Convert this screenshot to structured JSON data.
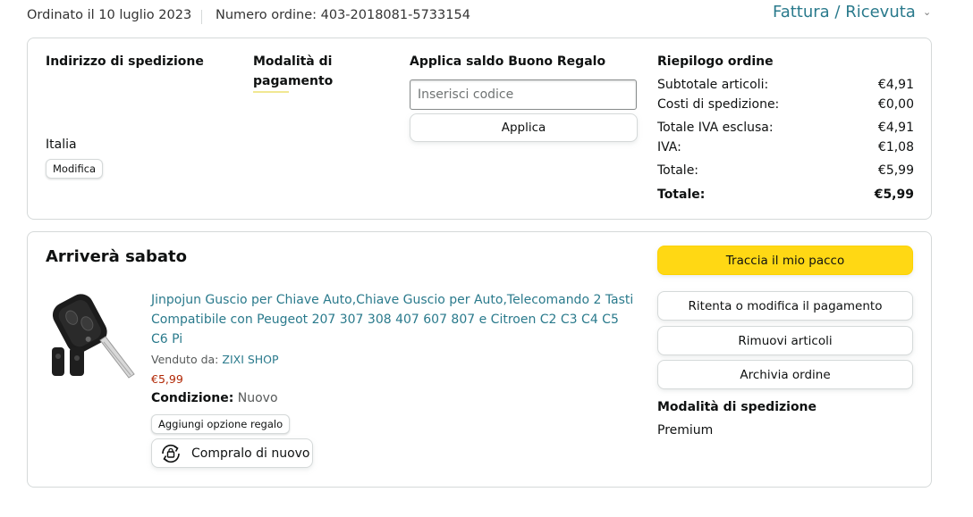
{
  "header": {
    "order_date": "Ordinato il 10 luglio 2023",
    "order_number": "Numero ordine: 403-2018081-5733154",
    "invoice_label": "Fattura / Ricevuta"
  },
  "summary_box": {
    "shipping_address": {
      "heading": "Indirizzo di spedizione",
      "country": "Italia",
      "edit_label": "Modifica"
    },
    "payment": {
      "heading_line1": "Modalità di",
      "heading_line2": "pagamento"
    },
    "gift_card": {
      "heading": "Applica saldo Buono Regalo",
      "placeholder": "Inserisci codice",
      "apply_label": "Applica"
    },
    "order_summary": {
      "heading": "Riepilogo ordine",
      "rows": [
        {
          "label": "Subtotale articoli:",
          "value": "€4,91",
          "bold": false
        },
        {
          "label": "Costi di spedizione:",
          "value": "€0,00",
          "bold": false
        },
        {
          "label": "Totale IVA esclusa:",
          "value": "€4,91",
          "bold": false
        },
        {
          "label": "IVA:",
          "value": "€1,08",
          "bold": false
        },
        {
          "label": "Totale:",
          "value": "€5,99",
          "bold": false
        },
        {
          "label": "Totale:",
          "value": "€5,99",
          "bold": true
        }
      ]
    }
  },
  "shipment": {
    "title": "Arriverà sabato",
    "product": {
      "title": "Jinpojun Guscio per Chiave Auto,Chiave Guscio per Auto,Telecomando 2 Tasti Compatibile con Peugeot 207 307 308 407 607 807 e Citroen C2 C3 C4 C5 C6 Pi",
      "sold_by_label": "Venduto da:",
      "seller": "ZIXI SHOP",
      "price": "€5,99",
      "condition_label": "Condizione:",
      "condition_value": "Nuovo",
      "gift_option_label": "Aggiungi opzione regalo",
      "buy_again_label": "Compralo di nuovo"
    },
    "actions": {
      "track": "Traccia il mio pacco",
      "retry_payment": "Ritenta o modifica il pagamento",
      "remove_items": "Rimuovi articoli",
      "archive_order": "Archivia ordine"
    },
    "shipping_method": {
      "heading": "Modalità di spedizione",
      "value": "Premium"
    }
  },
  "colors": {
    "link": "#2a7a8c",
    "price": "#b12704",
    "primary_button": "#ffd814",
    "border": "#d5d9d9"
  },
  "icons": [
    "chevron-down-icon",
    "buy-again-icon"
  ]
}
